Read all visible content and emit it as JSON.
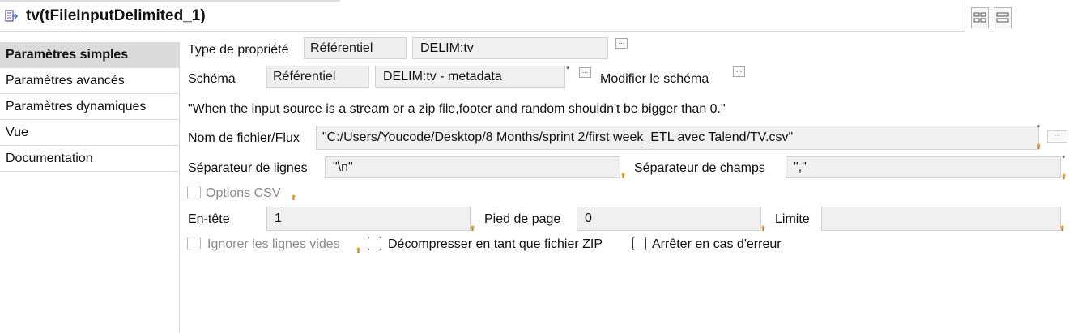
{
  "window": {
    "title": "tv(tFileInputDelimited_1)",
    "title_icon": "component-input-icon"
  },
  "sidebar": {
    "items": [
      {
        "label": "Paramètres simples",
        "active": true
      },
      {
        "label": "Paramètres avancés",
        "active": false
      },
      {
        "label": "Paramètres dynamiques",
        "active": false
      },
      {
        "label": "Vue",
        "active": false
      },
      {
        "label": "Documentation",
        "active": false
      }
    ]
  },
  "form": {
    "property_type": {
      "label": "Type de propriété",
      "mode": "Référentiel",
      "value": "DELIM:tv"
    },
    "schema": {
      "label": "Schéma",
      "mode": "Référentiel",
      "value": "DELIM:tv - metadata",
      "edit_label": "Modifier le schéma"
    },
    "note": "\"When the input source is a stream or a zip file,footer and random shouldn't be bigger than 0.\"",
    "filename": {
      "label": "Nom de fichier/Flux",
      "value": "\"C:/Users/Youcode/Desktop/8 Months/sprint 2/first week_ETL avec Talend/TV.csv\""
    },
    "row_separator": {
      "label": "Séparateur de lignes",
      "value": "\"\\n\""
    },
    "field_separator": {
      "label": "Séparateur de champs",
      "value": "\",\""
    },
    "csv_options": {
      "label": "Options CSV",
      "checked": false,
      "enabled": false
    },
    "header": {
      "label": "En-tête",
      "value": "1"
    },
    "footer": {
      "label": "Pied de page",
      "value": "0"
    },
    "limit": {
      "label": "Limite",
      "value": ""
    },
    "skip_empty": {
      "label": "Ignorer les lignes vides",
      "checked": false,
      "enabled": false
    },
    "unzip": {
      "label": "Décompresser en tant que fichier ZIP",
      "checked": false,
      "enabled": true
    },
    "die_on_error": {
      "label": "Arrêter en cas d'erreur",
      "checked": false,
      "enabled": true
    },
    "required_mark": "*",
    "ellipsis": "..."
  },
  "colors": {
    "active_tab": "#dadada",
    "field_bg": "#f0f0f0",
    "bulb": "#e8a33c"
  }
}
